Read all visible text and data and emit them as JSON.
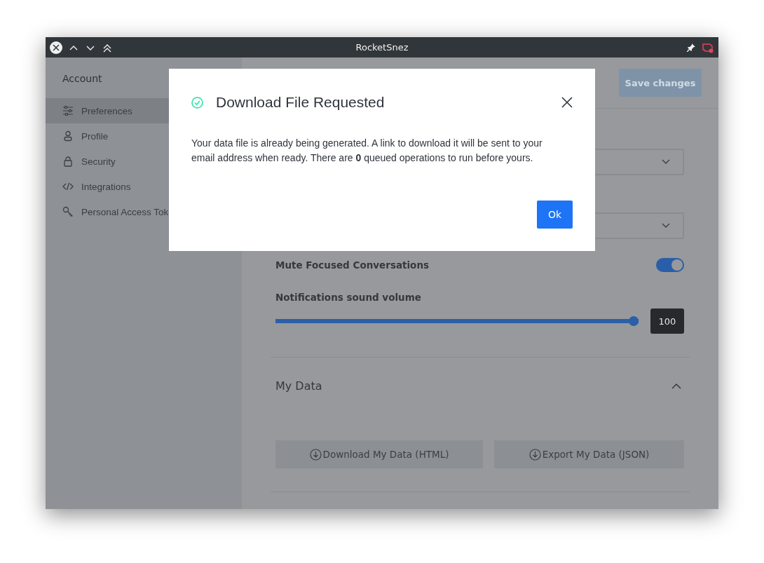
{
  "window": {
    "title": "RocketSnez"
  },
  "sidebar": {
    "heading": "Account",
    "items": [
      {
        "label": "Preferences",
        "selected": true
      },
      {
        "label": "Profile",
        "selected": false
      },
      {
        "label": "Security",
        "selected": false
      },
      {
        "label": "Integrations",
        "selected": false
      },
      {
        "label": "Personal Access Tok",
        "selected": false
      }
    ]
  },
  "main": {
    "save_button": {
      "label": "Save changes",
      "disabled": true
    },
    "mute_toggle": {
      "label": "Mute Focused Conversations",
      "on": true
    },
    "volume": {
      "label": "Notifications sound volume",
      "level": 1,
      "reading": "100"
    },
    "my_data": {
      "title": "My Data",
      "expanded": true,
      "buttons": [
        "Download My Data (HTML)",
        "Export My Data (JSON)"
      ]
    }
  },
  "dialog": {
    "title": "Download File Requested",
    "text": "Your data file is already being generated. A link to download it will be sent to your email address when ready. There are **0** queued operations to run before yours.",
    "button": "Ok"
  }
}
